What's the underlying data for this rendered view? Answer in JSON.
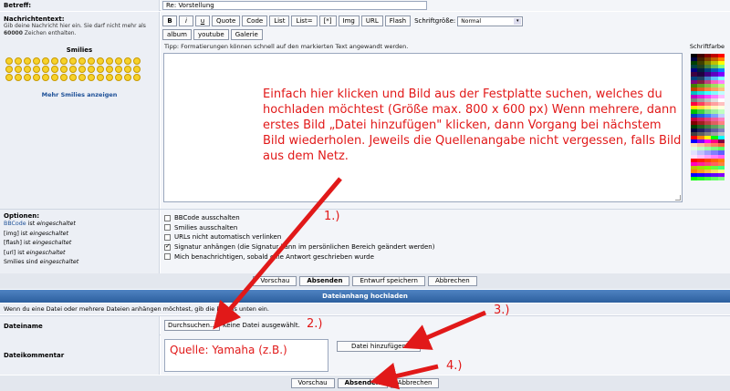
{
  "subject": {
    "label": "Betreff:",
    "value": "Re: Vorstellung"
  },
  "message": {
    "label": "Nachrichtentext:",
    "hint": "Gib deine Nachricht hier ein. Sie darf nicht mehr als",
    "limit_number": "60000",
    "limit_suffix": "Zeichen enthalten.",
    "smilies_title": "Smilies",
    "more_smilies": "Mehr Smilies anzeigen",
    "toolbar": [
      "B",
      "i",
      "u",
      "Quote",
      "Code",
      "List",
      "List=",
      "[*]",
      "Img",
      "URL",
      "Flash"
    ],
    "toolbar2": [
      "album",
      "youtube",
      "Galerie"
    ],
    "font_size_label": "Schriftgröße:",
    "font_size_value": "Normal",
    "tip": "Tipp: Formatierungen können schnell auf den markierten Text angewandt werden.",
    "palette_label": "Schriftfarbe",
    "palette_colors": [
      "#000000",
      "#400000",
      "#800000",
      "#c00000",
      "#ff0000",
      "#000040",
      "#402000",
      "#804000",
      "#c06000",
      "#ff8000",
      "#004000",
      "#404000",
      "#808000",
      "#c0c000",
      "#ffff00",
      "#004040",
      "#204020",
      "#408040",
      "#60c060",
      "#80ff80",
      "#000080",
      "#002040",
      "#004080",
      "#0060c0",
      "#0080ff",
      "#400040",
      "#200040",
      "#400080",
      "#6000c0",
      "#8000ff",
      "#004080",
      "#204060",
      "#4080c0",
      "#60c0ff",
      "#80ffff",
      "#800080",
      "#802040",
      "#c04080",
      "#ff60c0",
      "#ff80ff",
      "#408000",
      "#60a020",
      "#80c040",
      "#a0e060",
      "#c0ff80",
      "#c04000",
      "#e06020",
      "#ff8040",
      "#ffa060",
      "#ffc080",
      "#00c0c0",
      "#20e0e0",
      "#40ffff",
      "#80ffff",
      "#c0ffff",
      "#c000c0",
      "#e020e0",
      "#ff40ff",
      "#ff80ff",
      "#ffc0ff",
      "#808080",
      "#a0a0a0",
      "#c0c0c0",
      "#e0e0e0",
      "#ffffff",
      "#ff0040",
      "#ff4060",
      "#ff8080",
      "#ffa0a0",
      "#ffc0c0",
      "#ffe000",
      "#ffe040",
      "#fff080",
      "#fff8c0",
      "#ffffe0",
      "#00c000",
      "#40d040",
      "#80e080",
      "#a0f0a0",
      "#c0ffc0",
      "#0040c0",
      "#2060e0",
      "#4080ff",
      "#80a0ff",
      "#c0d0ff",
      "#c00040",
      "#d02060",
      "#e04080",
      "#f060a0",
      "#ff80c0",
      "#800000",
      "#a02020",
      "#c04040",
      "#e06060",
      "#ff8080",
      "#004000",
      "#206020",
      "#408040",
      "#60a060",
      "#80c080",
      "#000040",
      "#202060",
      "#404080",
      "#6060a0",
      "#8080c0",
      "#404040",
      "#606060",
      "#808080",
      "#a0a0a0",
      "#c0c0c0",
      "#ff0000",
      "#ff8000",
      "#ffff00",
      "#00ff00",
      "#00ffff",
      "#0000ff",
      "#8000ff",
      "#ff00ff",
      "#ff0080",
      "#800040",
      "#ffe0c0",
      "#ffc0a0",
      "#ffa080",
      "#ff8060",
      "#ff6040",
      "#e0ffe0",
      "#c0ffc0",
      "#a0ffa0",
      "#80ff80",
      "#60ff60",
      "#e0e0ff",
      "#c0c0ff",
      "#a0a0ff",
      "#8080ff",
      "#6060ff",
      "#ffe0ff",
      "#ffc0ff",
      "#ffa0ff",
      "#ff80ff",
      "#ff60ff",
      "#ff0000",
      "#ff2000",
      "#ff4000",
      "#ff6000",
      "#ff8000",
      "#ff00c0",
      "#ff20a0",
      "#ff4080",
      "#ff6060",
      "#ff8040",
      "#c0c000",
      "#a0e000",
      "#80ff00",
      "#60ff40",
      "#40ff80",
      "#ff8000",
      "#ffa020",
      "#ffc040",
      "#ffe060",
      "#ffff80",
      "#0000ff",
      "#2000ff",
      "#4000ff",
      "#6000ff",
      "#8000ff",
      "#00ff00",
      "#20ff20",
      "#40ff40",
      "#60ff60",
      "#80ff80"
    ]
  },
  "options": {
    "label": "Optionen:",
    "bbcode": "BBCode",
    "is": "ist",
    "enabled": "eingeschaltet",
    "img": "[img]",
    "flash": "[flash]",
    "url": "[url]",
    "smilies": "Smilies sind",
    "checks": [
      {
        "label": "BBCode ausschalten",
        "checked": false
      },
      {
        "label": "Smilies ausschalten",
        "checked": false
      },
      {
        "label": "URLs nicht automatisch verlinken",
        "checked": false
      },
      {
        "label": "Signatur anhängen (die Signatur kann im persönlichen Bereich geändert werden)",
        "checked": true
      },
      {
        "label": "Mich benachrichtigen, sobald eine Antwort geschrieben wurde",
        "checked": false
      }
    ]
  },
  "buttons": {
    "preview": "Vorschau",
    "submit": "Absenden",
    "draft": "Entwurf speichern",
    "cancel": "Abbrechen"
  },
  "attachment": {
    "header": "Dateianhang hochladen",
    "desc": "Wenn du eine Datei oder mehrere Dateien anhängen möchtest, gib die Details unten ein.",
    "filename_label": "Dateiname",
    "browse": "Durchsuchen...",
    "no_file": "Keine Datei ausgewählt.",
    "comment_label": "Dateikommentar",
    "comment_value": "Quelle: Yamaha (z.B.)",
    "add_file": "Datei hinzufügen"
  },
  "annotations": {
    "instruction": "Einfach hier klicken und Bild aus der Festplatte suchen, welches du hochladen möchtest (Größe max. 800 x 600 px) Wenn mehrere, dann erstes Bild „Datei hinzufügen\" klicken, dann Vorgang bei nächstem Bild wiederholen. Jeweils die Quellenangabe nicht vergessen, falls Bild aus dem Netz.",
    "step1": "1.)",
    "step2": "2.)",
    "step3": "3.)",
    "step4": "4.)",
    "color": "#e11919"
  }
}
